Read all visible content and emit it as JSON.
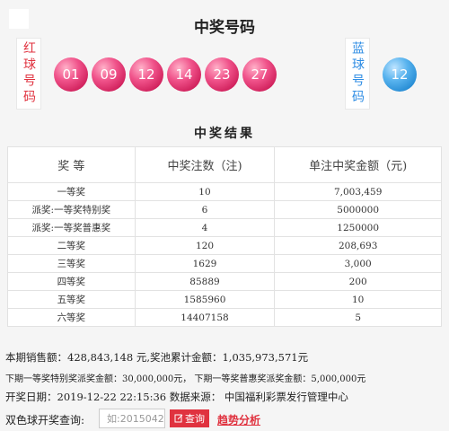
{
  "header": {
    "title": "中奖号码"
  },
  "balls": {
    "red_label": "红球号码",
    "blue_label": "蓝球号码",
    "red": [
      "01",
      "09",
      "12",
      "14",
      "23",
      "27"
    ],
    "blue": [
      "12"
    ],
    "colors": {
      "red": "#e8457a",
      "blue": "#3a9fe3"
    }
  },
  "results": {
    "title": "中奖结果",
    "columns": [
      "奖 等",
      "中奖注数（注)",
      "单注中奖金额（元)"
    ],
    "rows": [
      [
        "一等奖",
        "10",
        "7,003,459"
      ],
      [
        "派奖:一等奖特别奖",
        "6",
        "5000000"
      ],
      [
        "派奖:一等奖普惠奖",
        "4",
        "1250000"
      ],
      [
        "二等奖",
        "120",
        "208,693"
      ],
      [
        "三等奖",
        "1629",
        "3,000"
      ],
      [
        "四等奖",
        "85889",
        "200"
      ],
      [
        "五等奖",
        "1585960",
        "10"
      ],
      [
        "六等奖",
        "14407158",
        "5"
      ]
    ]
  },
  "info": {
    "sales": "本期销售额：428,843,148 元,奖池累计金额：1,035,973,571元",
    "dispatch": "下期一等奖特别奖派奖金额：30,000,000元， 下期一等奖普惠奖派奖金额：5,000,000元",
    "draw": "开奖日期：2019-12-22 22:15:36 数据来源： 中国福利彩票发行管理中心"
  },
  "query": {
    "label": "双色球开奖查询:",
    "placeholder": "如:2015042",
    "button": "查询",
    "trend": "趋势分析"
  }
}
